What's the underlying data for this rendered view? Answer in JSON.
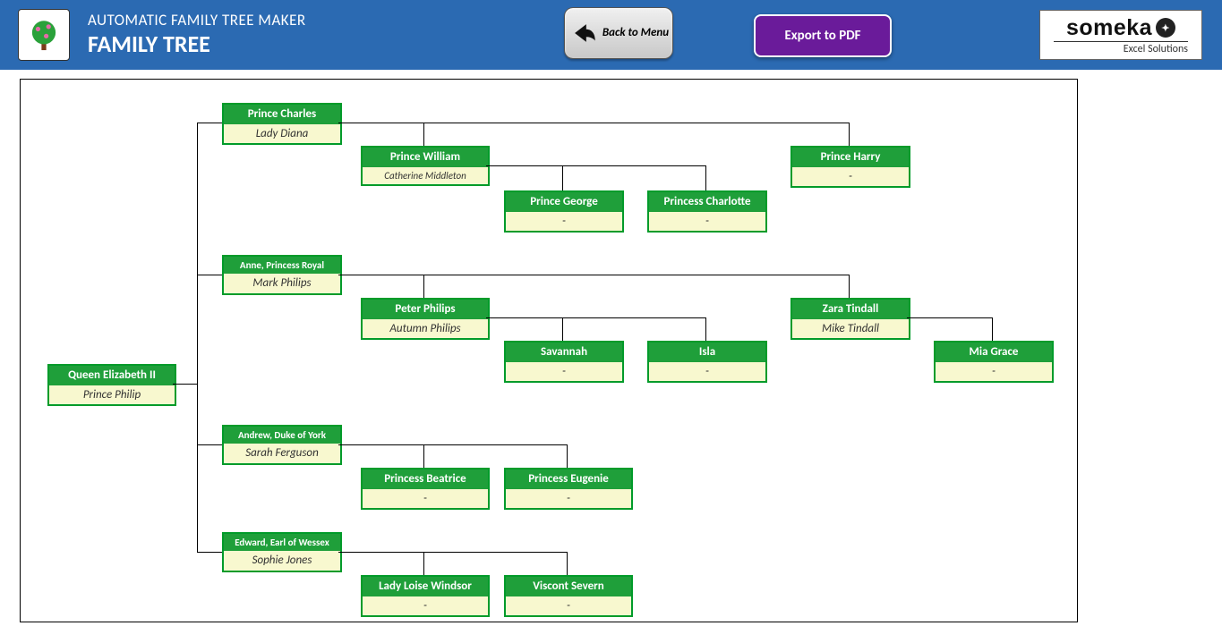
{
  "header": {
    "subtitle": "AUTOMATIC FAMILY TREE MAKER",
    "title": "FAMILY TREE",
    "back_label": "Back to Menu",
    "export_label": "Export to PDF",
    "logo_brand": "someka",
    "logo_tag": "Excel Solutions"
  },
  "tree": {
    "root": {
      "person": "Queen Elizabeth II",
      "spouse": "Prince Philip"
    },
    "children": [
      {
        "id": "charles",
        "person": "Prince Charles",
        "spouse": "Lady Diana",
        "small": false,
        "children": [
          {
            "id": "william",
            "person": "Prince William",
            "spouse": "Catherine Middleton",
            "children": [
              {
                "id": "george",
                "person": "Prince George",
                "spouse": "-"
              },
              {
                "id": "charlotte",
                "person": "Princess Charlotte",
                "spouse": "-"
              }
            ]
          },
          {
            "id": "harry",
            "person": "Prince Harry",
            "spouse": "-"
          }
        ]
      },
      {
        "id": "anne",
        "person": "Anne, Princess Royal",
        "spouse": "Mark Philips",
        "small": true,
        "children": [
          {
            "id": "peter",
            "person": "Peter Philips",
            "spouse": "Autumn Philips",
            "children": [
              {
                "id": "savannah",
                "person": "Savannah",
                "spouse": "-"
              },
              {
                "id": "isla",
                "person": "Isla",
                "spouse": "-"
              }
            ]
          },
          {
            "id": "zara",
            "person": "Zara Tindall",
            "spouse": "Mike Tindall",
            "children": [
              {
                "id": "mia",
                "person": "Mia Grace",
                "spouse": "-"
              }
            ]
          }
        ]
      },
      {
        "id": "andrew",
        "person": "Andrew, Duke of York",
        "spouse": "Sarah Ferguson",
        "small": true,
        "children": [
          {
            "id": "beatrice",
            "person": "Princess Beatrice",
            "spouse": "-"
          },
          {
            "id": "eugenie",
            "person": "Princess Eugenie",
            "spouse": "-"
          }
        ]
      },
      {
        "id": "edward",
        "person": "Edward, Earl of Wessex",
        "spouse": "Sophie Jones",
        "small": true,
        "children": [
          {
            "id": "louise",
            "person": "Lady Loise Windsor",
            "spouse": "-"
          },
          {
            "id": "severn",
            "person": "Viscont Severn",
            "spouse": "-"
          }
        ]
      }
    ]
  }
}
